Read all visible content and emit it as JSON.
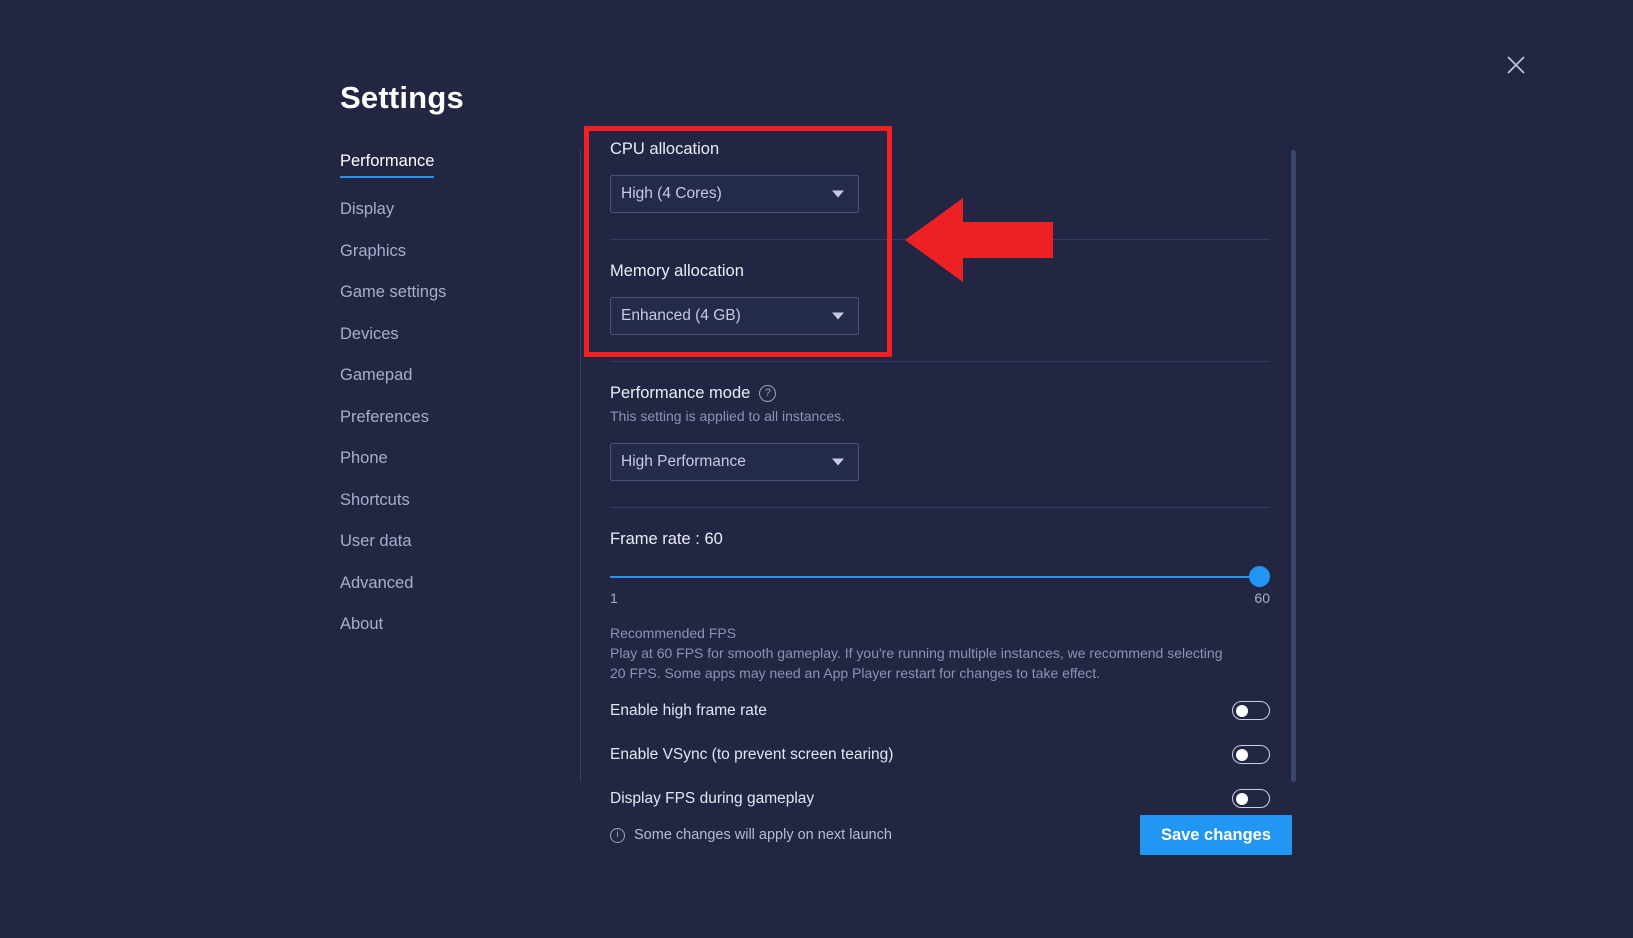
{
  "window": {
    "title": "Settings",
    "close_icon": "close-icon"
  },
  "sidebar": {
    "items": [
      {
        "label": "Performance",
        "active": true
      },
      {
        "label": "Display",
        "active": false
      },
      {
        "label": "Graphics",
        "active": false
      },
      {
        "label": "Game settings",
        "active": false
      },
      {
        "label": "Devices",
        "active": false
      },
      {
        "label": "Gamepad",
        "active": false
      },
      {
        "label": "Preferences",
        "active": false
      },
      {
        "label": "Phone",
        "active": false
      },
      {
        "label": "Shortcuts",
        "active": false
      },
      {
        "label": "User data",
        "active": false
      },
      {
        "label": "Advanced",
        "active": false
      },
      {
        "label": "About",
        "active": false
      }
    ]
  },
  "main": {
    "cpu": {
      "label": "CPU allocation",
      "value": "High (4 Cores)",
      "caret_icon": "chevron-down-icon"
    },
    "memory": {
      "label": "Memory allocation",
      "value": "Enhanced (4 GB)",
      "caret_icon": "chevron-down-icon"
    },
    "performance_mode": {
      "label": "Performance mode",
      "help_icon": "help-circle-icon",
      "help_glyph": "?",
      "description": "This setting is applied to all instances.",
      "value": "High Performance",
      "caret_icon": "chevron-down-icon"
    },
    "frame_rate": {
      "label": "Frame rate : 60",
      "value": 60,
      "min": 1,
      "max": 60,
      "min_label": "1",
      "max_label": "60",
      "recommended_heading": "Recommended FPS",
      "recommended_body": "Play at 60 FPS for smooth gameplay. If you're running multiple instances, we recommend selecting 20 FPS. Some apps may need an App Player restart for changes to take effect."
    },
    "toggles": [
      {
        "label": "Enable high frame rate",
        "on": false
      },
      {
        "label": "Enable VSync (to prevent screen tearing)",
        "on": false
      },
      {
        "label": "Display FPS during gameplay",
        "on": false
      }
    ]
  },
  "footer": {
    "note_icon": "info-circle-icon",
    "note_glyph": "i",
    "note": "Some changes will apply on next launch",
    "save_label": "Save changes"
  },
  "annotation": {
    "highlight_color": "#f21f23",
    "arrow_color": "#ed2024",
    "arrow_icon": "arrow-left-pointer"
  },
  "colors": {
    "background": "#222642",
    "accent": "#2196f3",
    "text_primary": "#e8ecf5",
    "text_muted": "#8b93b4"
  }
}
